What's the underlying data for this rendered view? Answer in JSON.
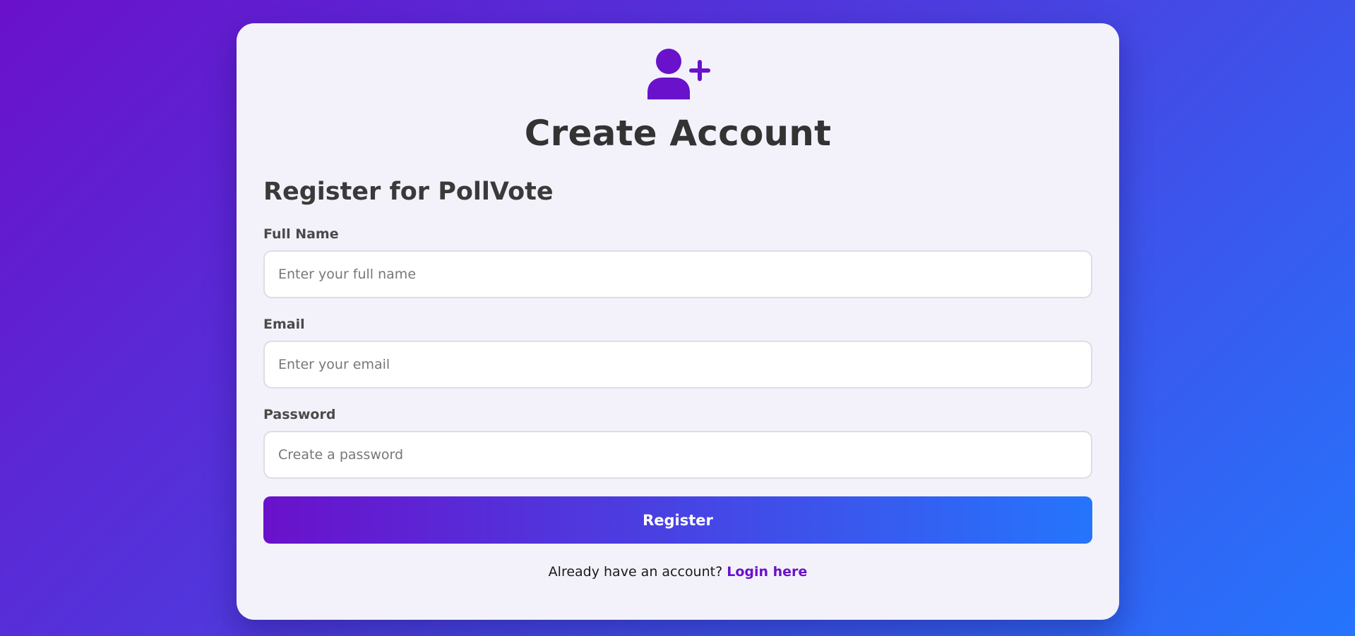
{
  "header": {
    "icon": "user-plus-icon",
    "title": "Create Account"
  },
  "form": {
    "subtitle": "Register for PollVote",
    "fields": {
      "full_name": {
        "label": "Full Name",
        "placeholder": "Enter your full name",
        "value": ""
      },
      "email": {
        "label": "Email",
        "placeholder": "Enter your email",
        "value": ""
      },
      "password": {
        "label": "Password",
        "placeholder": "Create a password",
        "value": ""
      }
    },
    "submit_label": "Register"
  },
  "footer": {
    "prompt": "Already have an account?",
    "link_label": "Login here"
  },
  "colors": {
    "accent": "#6a11cb",
    "gradient_start": "#6a11cb",
    "gradient_end": "#2575fc",
    "card_background": "#f3f2fa"
  }
}
